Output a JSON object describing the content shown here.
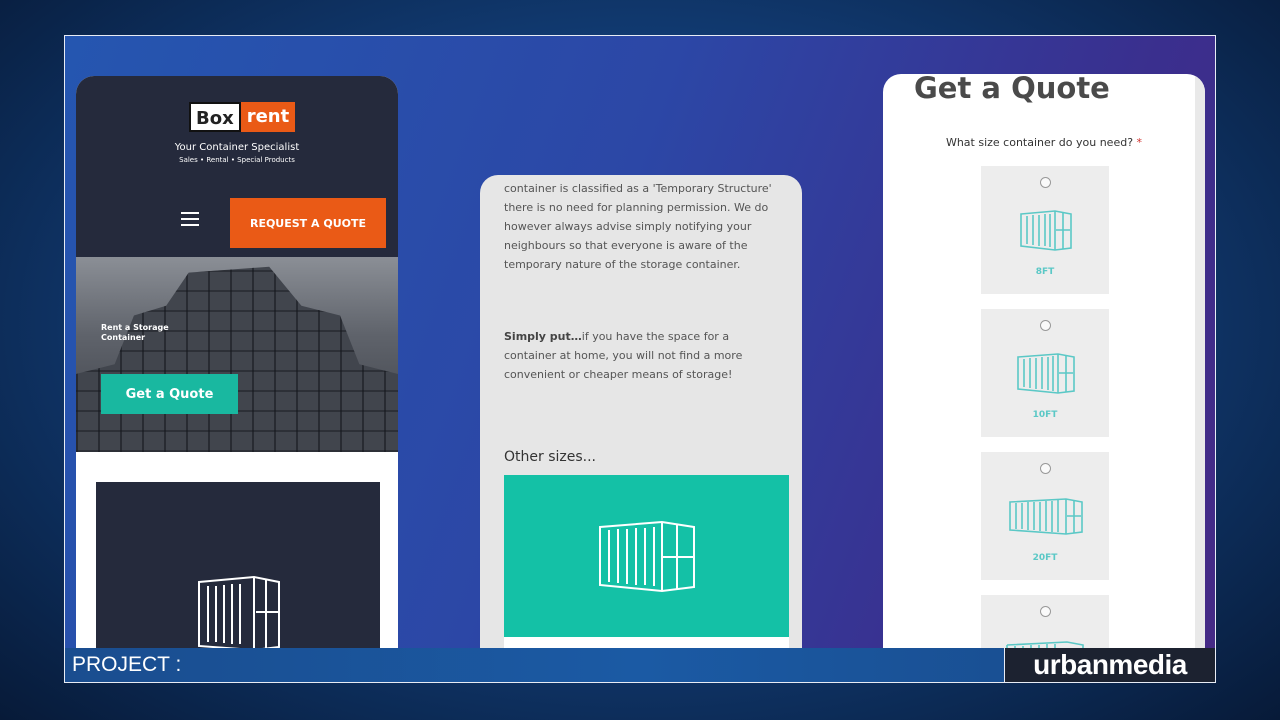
{
  "phone_left": {
    "logo_box": "Box",
    "logo_rent": "rent",
    "tagline": "Your Container Specialist",
    "subtagline": "Sales • Rental • Special Products",
    "request_button": "REQUEST A QUOTE",
    "hero_text": "Rent a Storage Container",
    "hero_button": "Get a Quote"
  },
  "phone_middle": {
    "paragraph1": "container is classified as a 'Temporary Structure' there is no need for planning permission. We do however always advise simply notifying your neighbours so that everyone is aware of the temporary nature of the storage container.",
    "paragraph2_bold": "Simply put…",
    "paragraph2": "if you have the space for a container at home, you will not find a more convenient or cheaper means of storage!",
    "other_sizes": "Other sizes..."
  },
  "phone_right": {
    "title": "Get a Quote",
    "question": "What size container do you need?",
    "required_mark": "*",
    "options": [
      "8FT",
      "10FT",
      "20FT"
    ]
  },
  "footer": {
    "project_label": "PROJECT :",
    "brand": "urbanmedia"
  },
  "colors": {
    "accent_orange": "#ea5a16",
    "teal": "#14c1a6",
    "navy": "#252a3c"
  }
}
